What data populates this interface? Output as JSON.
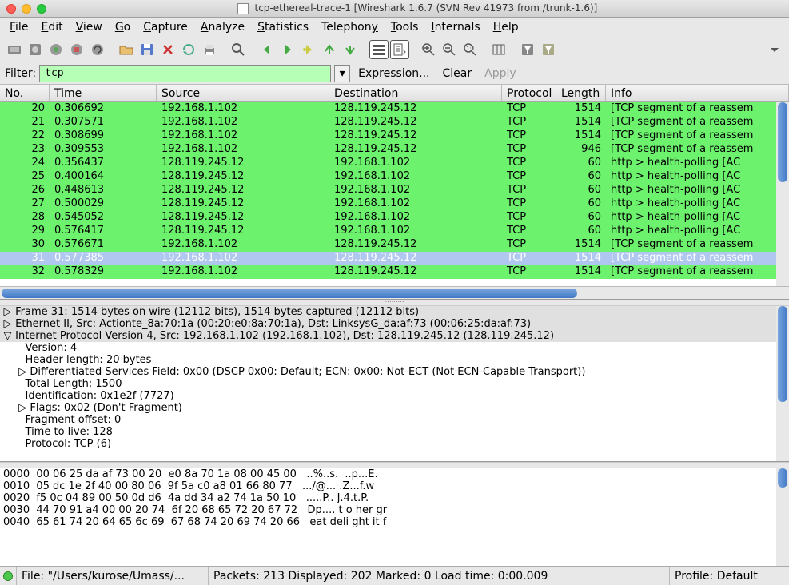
{
  "window": {
    "title": "tcp-ethereal-trace-1   [Wireshark 1.6.7  (SVN Rev 41973 from /trunk-1.6)]"
  },
  "menu": {
    "items": [
      "File",
      "Edit",
      "View",
      "Go",
      "Capture",
      "Analyze",
      "Statistics",
      "Telephony",
      "Tools",
      "Internals",
      "Help"
    ]
  },
  "filter": {
    "label": "Filter:",
    "value": "tcp",
    "expression": "Expression...",
    "clear": "Clear",
    "apply": "Apply"
  },
  "columns": {
    "no": "No.",
    "time": "Time",
    "source": "Source",
    "destination": "Destination",
    "protocol": "Protocol",
    "length": "Length",
    "info": "Info"
  },
  "packets": [
    {
      "no": "20",
      "time": "0.306692",
      "src": "192.168.1.102",
      "dst": "128.119.245.12",
      "proto": "TCP",
      "len": "1514",
      "info": "[TCP segment of a reassem",
      "cls": "green"
    },
    {
      "no": "21",
      "time": "0.307571",
      "src": "192.168.1.102",
      "dst": "128.119.245.12",
      "proto": "TCP",
      "len": "1514",
      "info": "[TCP segment of a reassem",
      "cls": "green"
    },
    {
      "no": "22",
      "time": "0.308699",
      "src": "192.168.1.102",
      "dst": "128.119.245.12",
      "proto": "TCP",
      "len": "1514",
      "info": "[TCP segment of a reassem",
      "cls": "green"
    },
    {
      "no": "23",
      "time": "0.309553",
      "src": "192.168.1.102",
      "dst": "128.119.245.12",
      "proto": "TCP",
      "len": "946",
      "info": "[TCP segment of a reassem",
      "cls": "green"
    },
    {
      "no": "24",
      "time": "0.356437",
      "src": "128.119.245.12",
      "dst": "192.168.1.102",
      "proto": "TCP",
      "len": "60",
      "info": "http > health-polling [AC",
      "cls": "green"
    },
    {
      "no": "25",
      "time": "0.400164",
      "src": "128.119.245.12",
      "dst": "192.168.1.102",
      "proto": "TCP",
      "len": "60",
      "info": "http > health-polling [AC",
      "cls": "green"
    },
    {
      "no": "26",
      "time": "0.448613",
      "src": "128.119.245.12",
      "dst": "192.168.1.102",
      "proto": "TCP",
      "len": "60",
      "info": "http > health-polling [AC",
      "cls": "green"
    },
    {
      "no": "27",
      "time": "0.500029",
      "src": "128.119.245.12",
      "dst": "192.168.1.102",
      "proto": "TCP",
      "len": "60",
      "info": "http > health-polling [AC",
      "cls": "green"
    },
    {
      "no": "28",
      "time": "0.545052",
      "src": "128.119.245.12",
      "dst": "192.168.1.102",
      "proto": "TCP",
      "len": "60",
      "info": "http > health-polling [AC",
      "cls": "green"
    },
    {
      "no": "29",
      "time": "0.576417",
      "src": "128.119.245.12",
      "dst": "192.168.1.102",
      "proto": "TCP",
      "len": "60",
      "info": "http > health-polling [AC",
      "cls": "green"
    },
    {
      "no": "30",
      "time": "0.576671",
      "src": "192.168.1.102",
      "dst": "128.119.245.12",
      "proto": "TCP",
      "len": "1514",
      "info": "[TCP segment of a reassem",
      "cls": "green"
    },
    {
      "no": "31",
      "time": "0.577385",
      "src": "192.168.1.102",
      "dst": "128.119.245.12",
      "proto": "TCP",
      "len": "1514",
      "info": "[TCP segment of a reassem",
      "cls": "sel"
    },
    {
      "no": "32",
      "time": "0.578329",
      "src": "192.168.1.102",
      "dst": "128.119.245.12",
      "proto": "TCP",
      "len": "1514",
      "info": "[TCP segment of a reassem",
      "cls": "green"
    }
  ],
  "details": [
    {
      "t": "▷",
      "txt": "Frame 31: 1514 bytes on wire (12112 bits), 1514 bytes captured (12112 bits)",
      "hl": true
    },
    {
      "t": "▷",
      "txt": "Ethernet II, Src: Actionte_8a:70:1a (00:20:e0:8a:70:1a), Dst: LinksysG_da:af:73 (00:06:25:da:af:73)",
      "hl": true
    },
    {
      "t": "▽",
      "txt": "Internet Protocol Version 4, Src: 192.168.1.102 (192.168.1.102), Dst: 128.119.245.12 (128.119.245.12)",
      "hl": true
    },
    {
      "t": " ",
      "txt": "   Version: 4"
    },
    {
      "t": " ",
      "txt": "   Header length: 20 bytes"
    },
    {
      "t": " ",
      "txt": " ▷ Differentiated Services Field: 0x00 (DSCP 0x00: Default; ECN: 0x00: Not-ECT (Not ECN-Capable Transport))"
    },
    {
      "t": " ",
      "txt": "   Total Length: 1500"
    },
    {
      "t": " ",
      "txt": "   Identification: 0x1e2f (7727)"
    },
    {
      "t": " ",
      "txt": " ▷ Flags: 0x02 (Don't Fragment)"
    },
    {
      "t": " ",
      "txt": "   Fragment offset: 0"
    },
    {
      "t": " ",
      "txt": "   Time to live: 128"
    },
    {
      "t": " ",
      "txt": "   Protocol: TCP (6)"
    }
  ],
  "hex": [
    "0000  00 06 25 da af 73 00 20  e0 8a 70 1a 08 00 45 00   ..%..s.  ..p...E.",
    "0010  05 dc 1e 2f 40 00 80 06  9f 5a c0 a8 01 66 80 77   .../@... .Z...f.w",
    "0020  f5 0c 04 89 00 50 0d d6  4a dd 34 a2 74 1a 50 10   .....P.. J.4.t.P.",
    "0030  44 70 91 a4 00 00 20 74  6f 20 68 65 72 20 67 72   Dp.... t o her gr",
    "0040  65 61 74 20 64 65 6c 69  67 68 74 20 69 74 20 66   eat deli ght it f"
  ],
  "status": {
    "file": "File: \"/Users/kurose/Umass/...",
    "packets": "Packets: 213 Displayed: 202 Marked: 0 Load time: 0:00.009",
    "profile": "Profile: Default"
  }
}
